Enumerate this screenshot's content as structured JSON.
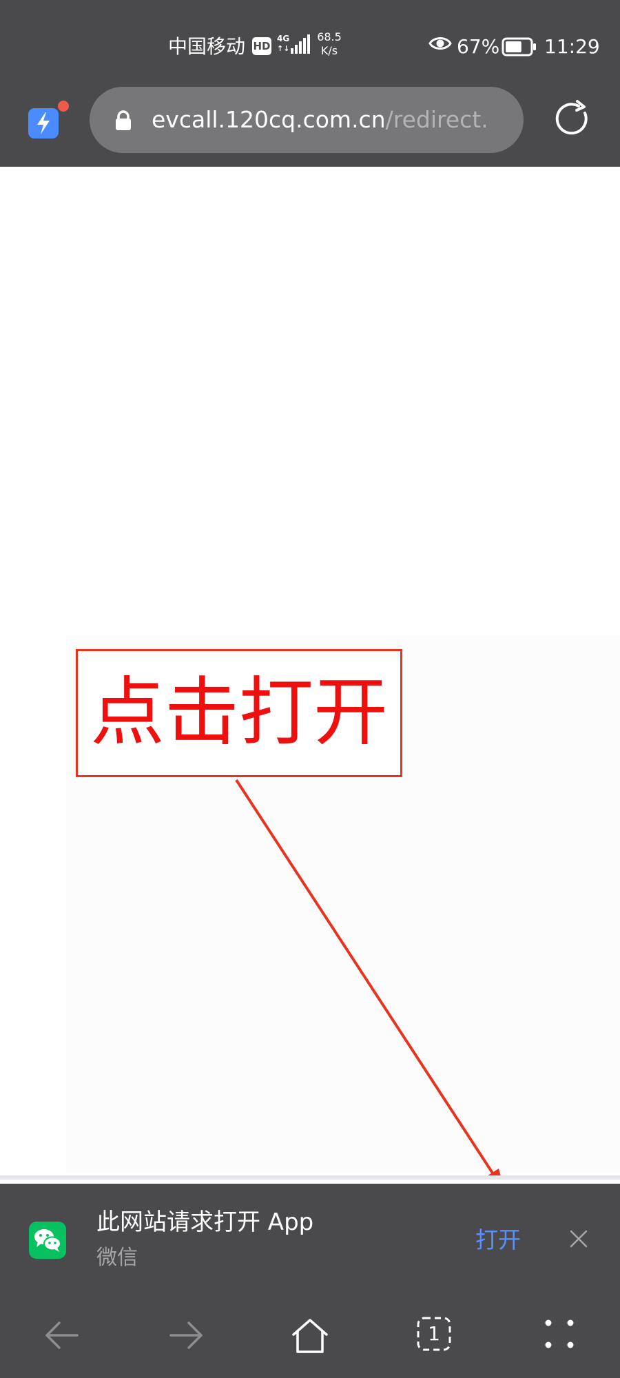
{
  "status_bar": {
    "carrier": "中国移动",
    "hd_badge": "HD",
    "network_type": "4G",
    "network_arrows": "↑↓",
    "net_speed_value": "68.5",
    "net_speed_unit": "K/s",
    "battery_percent": "67%",
    "battery_level": 0.67,
    "time": "11:29"
  },
  "address_bar": {
    "url_host": "evcall.120cq.com.cn",
    "url_path": "/redirect."
  },
  "annotation": {
    "text": "点击打开",
    "color": "#ee0f0f"
  },
  "open_app_banner": {
    "title": "此网站请求打开 App",
    "subtitle": "微信",
    "open_label": "打开",
    "accent_color": "#5b8ff9"
  },
  "bottom_nav": {
    "tab_count": "1",
    "items": [
      "back-icon",
      "forward-icon",
      "home-icon",
      "tabs-icon",
      "more-icon"
    ]
  },
  "colors": {
    "chrome_background": "#4a4a4c",
    "url_pill": "#777779",
    "wechat_green": "#07c160",
    "annotation_red": "#e8331f"
  }
}
